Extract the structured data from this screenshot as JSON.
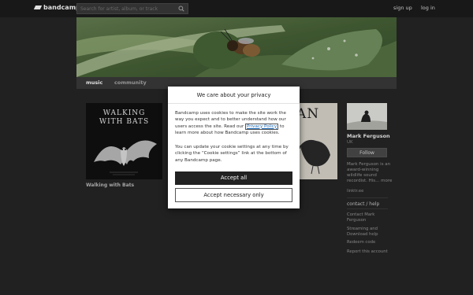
{
  "header": {
    "logo": "bandcamp",
    "search_placeholder": "Search for artist, album, or track",
    "signup": "sign up",
    "login": "log in"
  },
  "nav": {
    "tabs": [
      {
        "label": "music",
        "active": true
      },
      {
        "label": "community",
        "active": false
      }
    ]
  },
  "albums": [
    {
      "cover_line1": "WALKING",
      "cover_line2": "WITH BATS",
      "caption": "Walking with Bats"
    },
    {
      "cover_visible_text": "AN"
    }
  ],
  "artist": {
    "name": "Mark Ferguson",
    "location": "UK",
    "follow": "Follow",
    "bio": "Mark Ferguson is an award-winning wildlife sound recordist. His...",
    "bio_more": "more",
    "link": "linktr.ee",
    "contact_heading": "contact / help",
    "contact_links": [
      "Contact Mark Ferguson",
      "Streaming and Download help",
      "Redeem code",
      "Report this account"
    ]
  },
  "cookie_modal": {
    "title": "We care about your privacy",
    "p1_before": "Bandcamp uses cookies to make the site work the way you expect and to better understand how our users access the site. Read our ",
    "policy_link": "Privacy Policy",
    "p1_after": " to learn more about how Bandcamp uses cookies.",
    "p2": "You can update your cookie settings at any time by clicking the “Cookie settings” link at the bottom of any Bandcamp page.",
    "accept_all": "Accept all",
    "accept_necessary": "Accept necessary only"
  },
  "colors": {
    "page_bg": "#262626",
    "topbar_bg": "#1c1c1c",
    "nav_bg": "#3b3b3b",
    "accept_bg": "#222222",
    "link": "#1e6bb8"
  }
}
